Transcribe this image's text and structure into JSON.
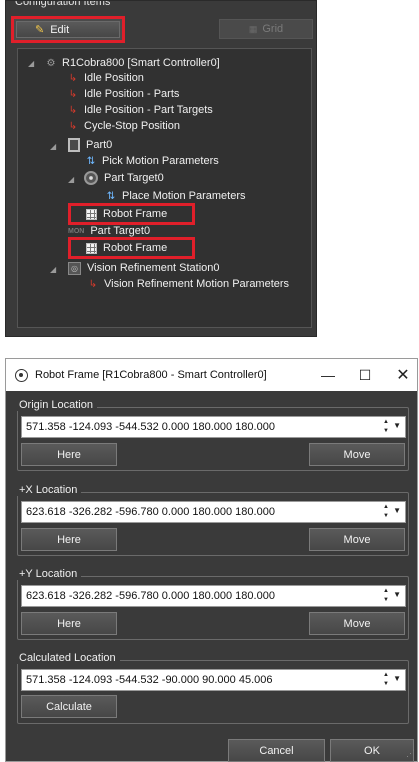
{
  "config": {
    "title": "Configuration Items",
    "edit_label": "Edit",
    "grid_label": "Grid",
    "tree": [
      {
        "label": "R1Cobra800 [Smart Controller0]"
      },
      {
        "label": "Idle Position"
      },
      {
        "label": "Idle Position - Parts"
      },
      {
        "label": "Idle Position - Part Targets"
      },
      {
        "label": "Cycle-Stop Position"
      },
      {
        "label": "Part0"
      },
      {
        "label": "Pick Motion Parameters"
      },
      {
        "label": "Part Target0"
      },
      {
        "label": "Place Motion Parameters"
      },
      {
        "label": "Robot Frame"
      },
      {
        "label": "Part Target0"
      },
      {
        "label": "Robot Frame"
      },
      {
        "label": "Vision Refinement Station0"
      },
      {
        "label": "Vision Refinement Motion Parameters"
      }
    ],
    "mon_badge": "MON"
  },
  "dialog": {
    "title": "Robot Frame [R1Cobra800 - Smart Controller0]",
    "origin": {
      "label": "Origin Location",
      "value": "571.358 -124.093 -544.532 0.000 180.000 180.000",
      "here": "Here",
      "move": "Move"
    },
    "plus_x": {
      "label": "+X Location",
      "value": "623.618 -326.282 -596.780 0.000 180.000 180.000",
      "here": "Here",
      "move": "Move"
    },
    "plus_y": {
      "label": "+Y Location",
      "value": "623.618 -326.282 -596.780 0.000 180.000 180.000",
      "here": "Here",
      "move": "Move"
    },
    "calculated": {
      "label": "Calculated Location",
      "value": "571.358 -124.093 -544.532 -90.000 90.000 45.006",
      "calculate": "Calculate"
    },
    "cancel_label": "Cancel",
    "ok_label": "OK"
  },
  "colors": {
    "panel_bg": "#3a3a3a",
    "highlight_red": "#e01f2a",
    "tree_bg": "#313131"
  }
}
